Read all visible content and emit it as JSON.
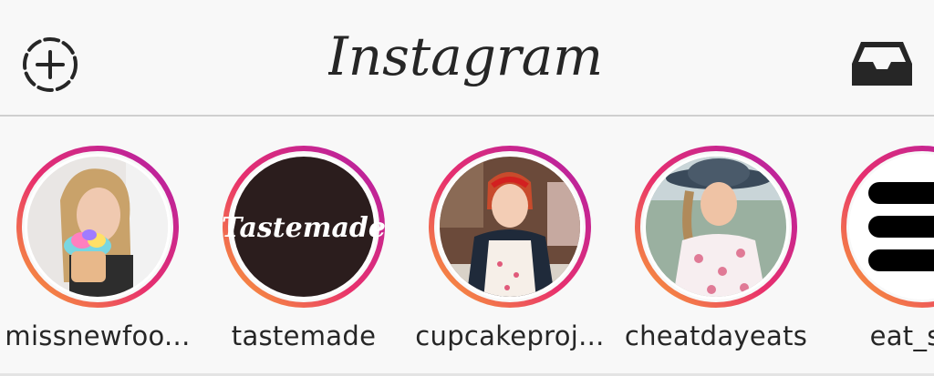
{
  "header": {
    "title": "Instagram",
    "new_story_icon": "add-story-icon",
    "inbox_icon": "inbox-tray-icon"
  },
  "stories": [
    {
      "username": "missnewfoo...",
      "avatar": "woman-holding-rainbow-cupcake"
    },
    {
      "username": "tastemade",
      "avatar": "tastemade-logo",
      "avatar_text": "Tastemade"
    },
    {
      "username": "cupcakeproj...",
      "avatar": "woman-in-apron-diner"
    },
    {
      "username": "cheatdayeats",
      "avatar": "woman-in-floral-dress-hat"
    },
    {
      "username": "eat_san",
      "avatar": "striped-logo"
    }
  ],
  "colors": {
    "ring_start": "#f58529",
    "ring_mid": "#dd2a7b",
    "ring_end": "#8134af",
    "text": "#262626",
    "background": "#f8f8f8"
  }
}
